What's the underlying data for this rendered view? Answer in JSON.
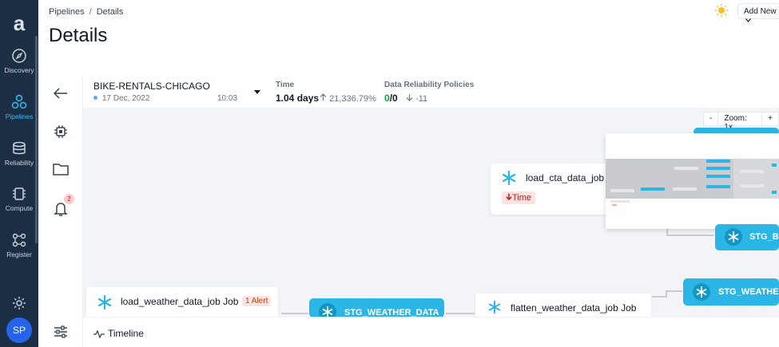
{
  "nav": {
    "logo": "a",
    "items": [
      {
        "label": "Discovery",
        "icon": "compass-icon"
      },
      {
        "label": "Pipelines",
        "icon": "pipelines-icon",
        "active": true
      },
      {
        "label": "Reliability",
        "icon": "database-icon"
      },
      {
        "label": "Compute",
        "icon": "chip-icon"
      },
      {
        "label": "Register",
        "icon": "register-icon"
      }
    ],
    "avatar_initials": "SP"
  },
  "header": {
    "breadcrumb": [
      "Pipelines",
      "Details"
    ],
    "title": "Details",
    "add_new_label": "Add New"
  },
  "tools": {
    "alert_count": "2"
  },
  "pipeline": {
    "name": "BIKE-RENTALS-CHICAGO",
    "date": "17 Dec, 2022",
    "time": "10:03"
  },
  "metrics": {
    "time_label": "Time",
    "time_value": "1.04 days",
    "time_delta": "21,336.79%",
    "policies_label": "Data Reliability Policies",
    "policies_value_pass": "0",
    "policies_value_total": "/0",
    "policies_delta": "-11"
  },
  "zoom": {
    "minus": "-",
    "label": "Zoom: 1x",
    "plus": "+"
  },
  "nodes": {
    "load_cta": "load_cta_data_job",
    "load_cta_tag": "Time",
    "load_weather": "load_weather_data_job Job",
    "load_weather_tag": "1 Alert",
    "stg_weather_data": "STG_WEATHER_DATA",
    "flatten_weather": "flatten_weather_data_job Job",
    "stg_weather_right": "STG_WEATHER",
    "stg_b": "STG_B"
  },
  "bottom": {
    "timeline_label": "Timeline"
  },
  "colors": {
    "nav_bg": "#1c2e44",
    "accent": "#38bdf8",
    "node_blue": "#2cb6e6",
    "alert_red": "#b91c1c"
  }
}
